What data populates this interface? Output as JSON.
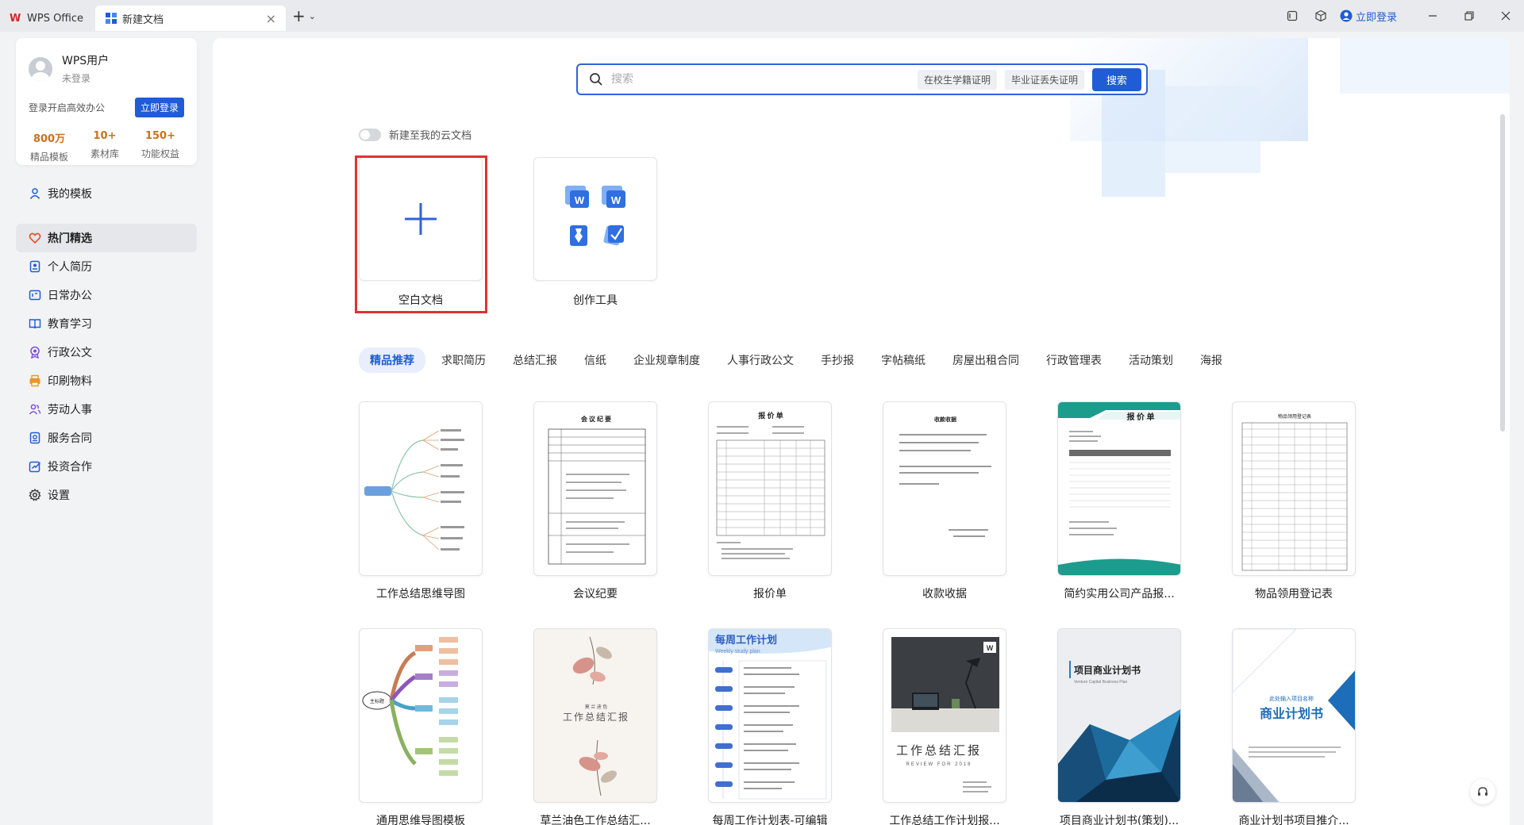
{
  "titlebar": {
    "app_tab": "WPS Office",
    "doc_tab": "新建文档",
    "close_glyph": "×",
    "add_glyph": "+",
    "chevron_glyph": "⌄",
    "login": "立即登录"
  },
  "user": {
    "name": "WPS用户",
    "status": "未登录",
    "prompt": "登录开启高效办公",
    "login_button": "立即登录",
    "stats": [
      {
        "num": "800万",
        "label": "精品模板"
      },
      {
        "num": "10+",
        "label": "素材库"
      },
      {
        "num": "150+",
        "label": "功能权益"
      }
    ]
  },
  "nav": {
    "my_templates": "我的模板",
    "items": [
      {
        "label": "热门精选",
        "icon": "heart-icon"
      },
      {
        "label": "个人简历",
        "icon": "resume-icon"
      },
      {
        "label": "日常办公",
        "icon": "office-icon"
      },
      {
        "label": "教育学习",
        "icon": "book-icon"
      },
      {
        "label": "行政公文",
        "icon": "seal-icon"
      },
      {
        "label": "印刷物料",
        "icon": "print-icon"
      },
      {
        "label": "劳动人事",
        "icon": "people-icon"
      },
      {
        "label": "服务合同",
        "icon": "contract-icon"
      },
      {
        "label": "投资合作",
        "icon": "invest-icon"
      },
      {
        "label": "设置",
        "icon": "gear-icon"
      }
    ]
  },
  "search": {
    "placeholder": "搜索",
    "chips": [
      "在校生学籍证明",
      "毕业证丢失证明"
    ],
    "button": "搜索"
  },
  "cloud_toggle": "新建至我的云文档",
  "create": {
    "blank": "空白文档",
    "tools": "创作工具"
  },
  "categories": [
    "精品推荐",
    "求职简历",
    "总结汇报",
    "信纸",
    "企业规章制度",
    "人事行政公文",
    "手抄报",
    "字帖稿纸",
    "房屋出租合同",
    "行政管理表",
    "活动策划",
    "海报"
  ],
  "templates": [
    {
      "name": "工作总结思维导图"
    },
    {
      "name": "会议纪要",
      "title": "会 议 纪 要"
    },
    {
      "name": "报价单",
      "title": "报 价 单"
    },
    {
      "name": "收款收据",
      "title": "收款收据"
    },
    {
      "name": "简约实用公司产品报...",
      "title": "报 价 单"
    },
    {
      "name": "物品领用登记表",
      "title": "物品领用登记表"
    },
    {
      "name": "通用思维导图模板",
      "title": "主标题"
    },
    {
      "name": "草兰油色工作总结汇...",
      "title": "工作总结汇报",
      "sub": "莫 兰 迪 色"
    },
    {
      "name": "每周工作计划表-可编辑",
      "title": "每周工作计划",
      "sub": "Weekly study plan"
    },
    {
      "name": "工作总结工作计划报...",
      "title": "工作总结汇报",
      "sub": "REVIEW FOR 2018"
    },
    {
      "name": "项目商业计划书(策划)...",
      "title": "项目商业计划书",
      "sub": "Venture Capital Business Plan"
    },
    {
      "name": "商业计划书项目推介...",
      "title": "商业计划书",
      "sub": "此处输入项目名称"
    }
  ]
}
